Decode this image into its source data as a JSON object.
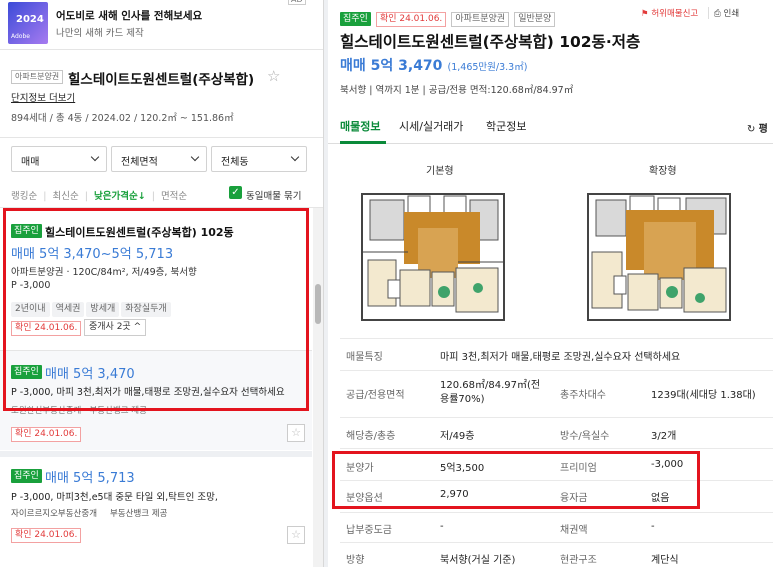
{
  "ad": {
    "title": "어도비로 새해 인사를 전해보세요",
    "subtitle": "나만의 새해 카드 제작",
    "thumb_text": "2024",
    "brand": "Adobe",
    "ad_mark": "AD"
  },
  "complex": {
    "type_badge": "아파트분양권",
    "name": "힐스테이트도원센트럴(주상복합)",
    "info_link": "단지정보 더보기",
    "summary": "894세대 / 총 4동 / 2024.02 / 120.2㎡ ~ 151.86㎡"
  },
  "filters": {
    "trade": "매매",
    "area": "전체면적",
    "dong": "전체동"
  },
  "sort": {
    "options": [
      "랭킹순",
      "최신순",
      "낮은가격순↓",
      "면적순"
    ],
    "same_listing_label": "동일매물 묶기"
  },
  "listing1": {
    "direct_badge": "집주인",
    "title": "힐스테이트도원센트럴(주상복합) 102동",
    "price": "매매 5억 3,470~5억 5,713",
    "spec": "아파트분양권 · 120C/84m², 저/49층, 북서향",
    "premium": "P -3,000",
    "tags": [
      "2년이내",
      "역세권",
      "방세개",
      "화장실두개"
    ],
    "confirm": "확인 24.01.06.",
    "broker_toggle": "중개사 2곳"
  },
  "listing1_sub": {
    "direct_badge": "집주인",
    "price": "매매 5억 3,470",
    "desc": "P -3,000, 마피 3천,최저가 매물,태평로 조망권,실수요자 선택하세요",
    "agent": "도원한신부동산중개 · 부동산뱅크 제공",
    "confirm": "확인 24.01.06."
  },
  "listing2": {
    "direct_badge": "집주인",
    "price": "매매 5억 5,713",
    "desc": "P -3,000, 마피3천,e5대 중문 타일 외,탁트인 조망,",
    "agent": "자이르르지오부동산중개",
    "source": "부동산뱅크 제공",
    "confirm": "확인 24.01.06."
  },
  "detail": {
    "direct_badge": "집주인",
    "confirm": "확인 24.01.06.",
    "type_badge": "아파트분양권",
    "trade_badge": "일반분양",
    "report_link": "허위매물신고",
    "print_link": "인쇄",
    "title": "힐스테이트도원센트럴(주상복합) 102동·저층",
    "price": "매매 5억 3,470",
    "price_per": "(1,465만원/3.3㎡)",
    "sub_info": "북서향 | 역까지 1분 | 공급/전용 면적:120.68㎡/84.97㎡",
    "tabs": [
      "매물정보",
      "시세/실거래가",
      "학군정보"
    ],
    "tab_right": "평",
    "floorplan_labels": [
      "기본형",
      "확장형"
    ]
  },
  "info_rows": [
    {
      "k1": "매물특징",
      "v1": "마피 3천,최저가 매물,태평로 조망권,실수요자 선택하세요",
      "k2": "",
      "v2": ""
    },
    {
      "k1": "공급/전용면적",
      "v1": "120.68㎡/84.97㎡(전용률70%)",
      "k2": "총주차대수",
      "v2": "1239대(세대당 1.38대)"
    },
    {
      "k1": "해당층/총층",
      "v1": "저/49층",
      "k2": "방수/욕실수",
      "v2": "3/2개"
    },
    {
      "k1": "분양가",
      "v1": "5억3,500",
      "k2": "프리미엄",
      "v2": "-3,000"
    },
    {
      "k1": "분양옵션",
      "v1": "2,970",
      "k2": "융자금",
      "v2": "없음"
    },
    {
      "k1": "납부중도금",
      "v1": "-",
      "k2": "채권액",
      "v2": "-"
    },
    {
      "k1": "방향",
      "v1": "북서향(거실 기준)",
      "k2": "현관구조",
      "v2": "계단식"
    }
  ],
  "colors": {
    "accent_blue": "#3a7bd5",
    "direct_green": "#19a03c",
    "highlight_red": "#e3141e",
    "tab_green": "#0b8a3a"
  }
}
